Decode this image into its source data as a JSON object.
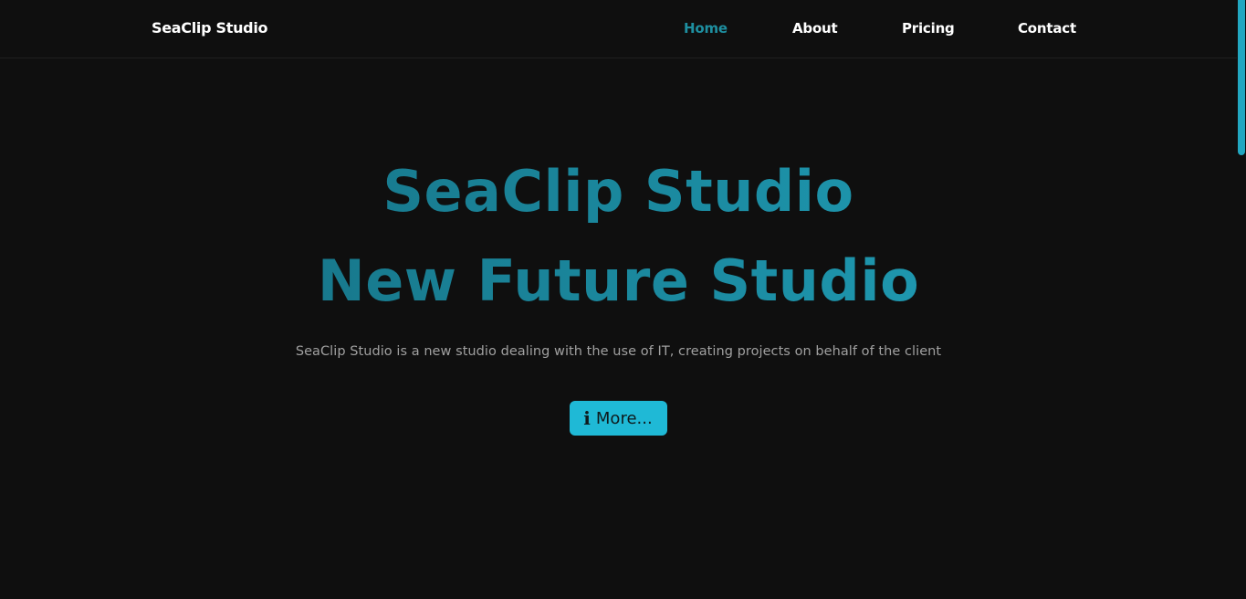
{
  "navbar": {
    "brand": "SeaClip Studio",
    "links": [
      {
        "label": "Home",
        "active": true
      },
      {
        "label": "About",
        "active": false
      },
      {
        "label": "Pricing",
        "active": false
      },
      {
        "label": "Contact",
        "active": false
      }
    ]
  },
  "hero": {
    "headline_line1": "SeaClip Studio",
    "headline_line2": "New Future Studio",
    "subtitle": "SeaClip Studio is a new studio dealing with the use of IT, creating projects on behalf of the client",
    "button": {
      "icon": "info-icon",
      "icon_glyph": "i",
      "label": "More..."
    }
  },
  "colors": {
    "background": "#0f0f0f",
    "accent": "#1fb9d6",
    "nav_active": "#1e8fa0",
    "headline_start": "#156a7c",
    "headline_end": "#22a7c1"
  },
  "scrollbar": {
    "position_fraction": 0
  }
}
